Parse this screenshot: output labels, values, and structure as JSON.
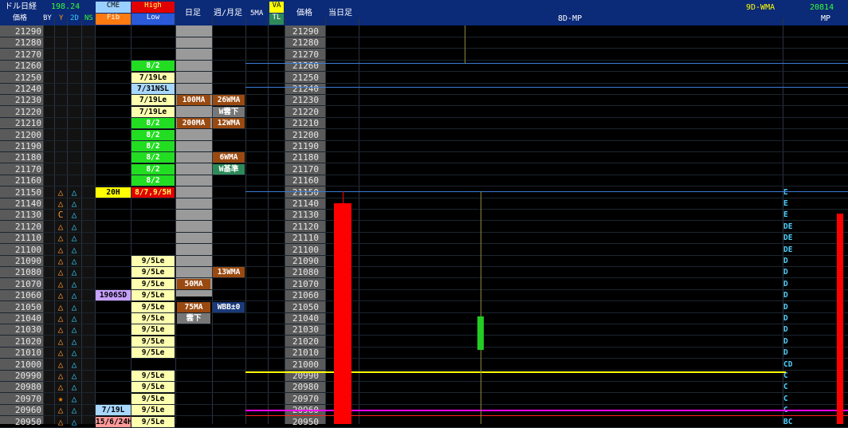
{
  "header": {
    "instrument_label": "ドル日経",
    "instrument_value": "198.24",
    "col_price": "価格",
    "col_by": "BY",
    "col_y": "Y",
    "col_2d": "2D",
    "col_ns": "NS",
    "cme_label": "CME",
    "fib_label": "Fib",
    "high_label": "High",
    "low_label": "Low",
    "daily_label": "日足",
    "weekly_monthly_label": "週/月足",
    "ma5_label": "5MA",
    "va_label": "VA",
    "tl_label": "TL",
    "price2_label": "価格",
    "today_label": "当日足",
    "mp8d_label": "8D-MP",
    "wma9d_label": "9D-WMA",
    "mp_value": "20814",
    "mp_label": "MP"
  },
  "prices": [
    "21290",
    "21280",
    "21270",
    "21260",
    "21250",
    "21240",
    "21230",
    "21220",
    "21210",
    "21200",
    "21190",
    "21180",
    "21170",
    "21160",
    "21150",
    "21140",
    "21130",
    "21120",
    "21110",
    "21100",
    "21090",
    "21080",
    "21070",
    "21060",
    "21050",
    "21040",
    "21030",
    "21020",
    "21010",
    "21000",
    "20990",
    "20980",
    "20970",
    "20960",
    "20950"
  ],
  "sym_y": [
    "",
    "",
    "",
    "",
    "",
    "",
    "",
    "",
    "",
    "",
    "",
    "",
    "",
    "",
    "△",
    "△",
    "C",
    "△",
    "△",
    "△",
    "△",
    "△",
    "△",
    "△",
    "△",
    "△",
    "△",
    "△",
    "△",
    "△",
    "△",
    "△",
    "★",
    "△",
    "△"
  ],
  "sym_2d": [
    "",
    "",
    "",
    "",
    "",
    "",
    "",
    "",
    "",
    "",
    "",
    "",
    "",
    "",
    "△",
    "△",
    "△",
    "△",
    "△",
    "△",
    "△",
    "△",
    "△",
    "△",
    "△",
    "△",
    "△",
    "△",
    "△",
    "△",
    "△",
    "△",
    "△",
    "△",
    "△"
  ],
  "cme_cells": [
    {
      "row": 14,
      "text": "20H",
      "bg": "#ffff00",
      "fg": "#000000"
    },
    {
      "row": 23,
      "text": "1906SD",
      "bg": "#c8a0ff",
      "fg": "#000000"
    },
    {
      "row": 33,
      "text": "7/19L",
      "bg": "#a8d8ff",
      "fg": "#000000"
    },
    {
      "row": 34,
      "text": "15/6/24H",
      "bg": "#ff9a9a",
      "fg": "#000000"
    }
  ],
  "hl_cells": [
    {
      "row": 3,
      "text": "8/2",
      "bg": "#22dd22",
      "fg": "#ffffff"
    },
    {
      "row": 4,
      "text": "7/19Le",
      "bg": "#ffffb0",
      "fg": "#000000"
    },
    {
      "row": 5,
      "text": "7/31NSL",
      "bg": "#a8d8ff",
      "fg": "#000000"
    },
    {
      "row": 6,
      "text": "7/19Le",
      "bg": "#ffffb0",
      "fg": "#000000"
    },
    {
      "row": 7,
      "text": "7/19Le",
      "bg": "#ffffb0",
      "fg": "#000000"
    },
    {
      "row": 8,
      "text": "8/2",
      "bg": "#22dd22",
      "fg": "#ffffff"
    },
    {
      "row": 9,
      "text": "8/2",
      "bg": "#22dd22",
      "fg": "#ffffff"
    },
    {
      "row": 10,
      "text": "8/2",
      "bg": "#22dd22",
      "fg": "#ffffff"
    },
    {
      "row": 11,
      "text": "8/2",
      "bg": "#22dd22",
      "fg": "#ffffff"
    },
    {
      "row": 12,
      "text": "8/2",
      "bg": "#22dd22",
      "fg": "#ffffff"
    },
    {
      "row": 13,
      "text": "8/2",
      "bg": "#22dd22",
      "fg": "#ffffff"
    },
    {
      "row": 14,
      "text": "8/7,9/5H",
      "bg": "#e00000",
      "fg": "#ffff66"
    },
    {
      "row": 20,
      "text": "9/5Le",
      "bg": "#ffffb0",
      "fg": "#000000"
    },
    {
      "row": 21,
      "text": "9/5Le",
      "bg": "#ffffb0",
      "fg": "#000000"
    },
    {
      "row": 22,
      "text": "9/5Le",
      "bg": "#ffffb0",
      "fg": "#000000"
    },
    {
      "row": 23,
      "text": "9/5Le",
      "bg": "#ffffb0",
      "fg": "#000000"
    },
    {
      "row": 24,
      "text": "9/5Le",
      "bg": "#ffffb0",
      "fg": "#000000"
    },
    {
      "row": 25,
      "text": "9/5Le",
      "bg": "#ffffb0",
      "fg": "#000000"
    },
    {
      "row": 26,
      "text": "9/5Le",
      "bg": "#ffffb0",
      "fg": "#000000"
    },
    {
      "row": 27,
      "text": "9/5Le",
      "bg": "#ffffb0",
      "fg": "#000000"
    },
    {
      "row": 28,
      "text": "9/5Le",
      "bg": "#ffffb0",
      "fg": "#000000"
    },
    {
      "row": 30,
      "text": "9/5Le",
      "bg": "#ffffb0",
      "fg": "#000000"
    },
    {
      "row": 31,
      "text": "9/5Le",
      "bg": "#ffffb0",
      "fg": "#000000"
    },
    {
      "row": 32,
      "text": "9/5Le",
      "bg": "#ffffb0",
      "fg": "#000000"
    },
    {
      "row": 33,
      "text": "9/5Le",
      "bg": "#ffffb0",
      "fg": "#000000"
    },
    {
      "row": 34,
      "text": "9/5Le",
      "bg": "#ffffb0",
      "fg": "#000000"
    }
  ],
  "daily_cells": [
    {
      "row": 6,
      "text": "100MA",
      "bg": "#9a4a10",
      "fg": "#ffffff"
    },
    {
      "row": 8,
      "text": "200MA",
      "bg": "#9a4a10",
      "fg": "#ffffff"
    },
    {
      "row": 22,
      "text": "50MA",
      "bg": "#9a4a10",
      "fg": "#ffffff"
    },
    {
      "row": 24,
      "text": "75MA",
      "bg": "#9a4a10",
      "fg": "#ffffff"
    },
    {
      "row": 25,
      "text": "雲下",
      "bg": "#777777",
      "fg": "#ffffff"
    }
  ],
  "weekly_cells": [
    {
      "row": 6,
      "text": "26WMA",
      "bg": "#9a4a10",
      "fg": "#ffffff"
    },
    {
      "row": 7,
      "text": "W雲下",
      "bg": "#777777",
      "fg": "#ffffff"
    },
    {
      "row": 8,
      "text": "12WMA",
      "bg": "#9a4a10",
      "fg": "#ffffff"
    },
    {
      "row": 11,
      "text": "6WMA",
      "bg": "#9a4a10",
      "fg": "#ffffff"
    },
    {
      "row": 12,
      "text": "W基準",
      "bg": "#2e8a5a",
      "fg": "#ffffff"
    },
    {
      "row": 21,
      "text": "13WMA",
      "bg": "#9a4a10",
      "fg": "#ffffff"
    },
    {
      "row": 24,
      "text": "WBB±0",
      "bg": "#1a3a7a",
      "fg": "#ffffff"
    }
  ],
  "mp_letters": [
    {
      "row": 14,
      "text": "E"
    },
    {
      "row": 15,
      "text": "E"
    },
    {
      "row": 16,
      "text": "E"
    },
    {
      "row": 17,
      "text": "DE"
    },
    {
      "row": 18,
      "text": "DE"
    },
    {
      "row": 19,
      "text": "DE"
    },
    {
      "row": 20,
      "text": "D"
    },
    {
      "row": 21,
      "text": "D"
    },
    {
      "row": 22,
      "text": "D"
    },
    {
      "row": 23,
      "text": "D"
    },
    {
      "row": 24,
      "text": "D"
    },
    {
      "row": 25,
      "text": "D"
    },
    {
      "row": 26,
      "text": "D"
    },
    {
      "row": 27,
      "text": "D"
    },
    {
      "row": 28,
      "text": "D"
    },
    {
      "row": 29,
      "text": "CD"
    },
    {
      "row": 30,
      "text": "C"
    },
    {
      "row": 31,
      "text": "C"
    },
    {
      "row": 32,
      "text": "C"
    },
    {
      "row": 33,
      "text": "C"
    },
    {
      "row": 34,
      "text": "BC"
    }
  ],
  "colors": {
    "header_bg": "#0b2a78",
    "today_candle": "#ff0000",
    "mini_candle": "#22cc22",
    "blue_line": "#3a7bd5",
    "yellow_line": "#ffff00",
    "magenta_line": "#ff00ff",
    "red_line": "#ff2020"
  }
}
